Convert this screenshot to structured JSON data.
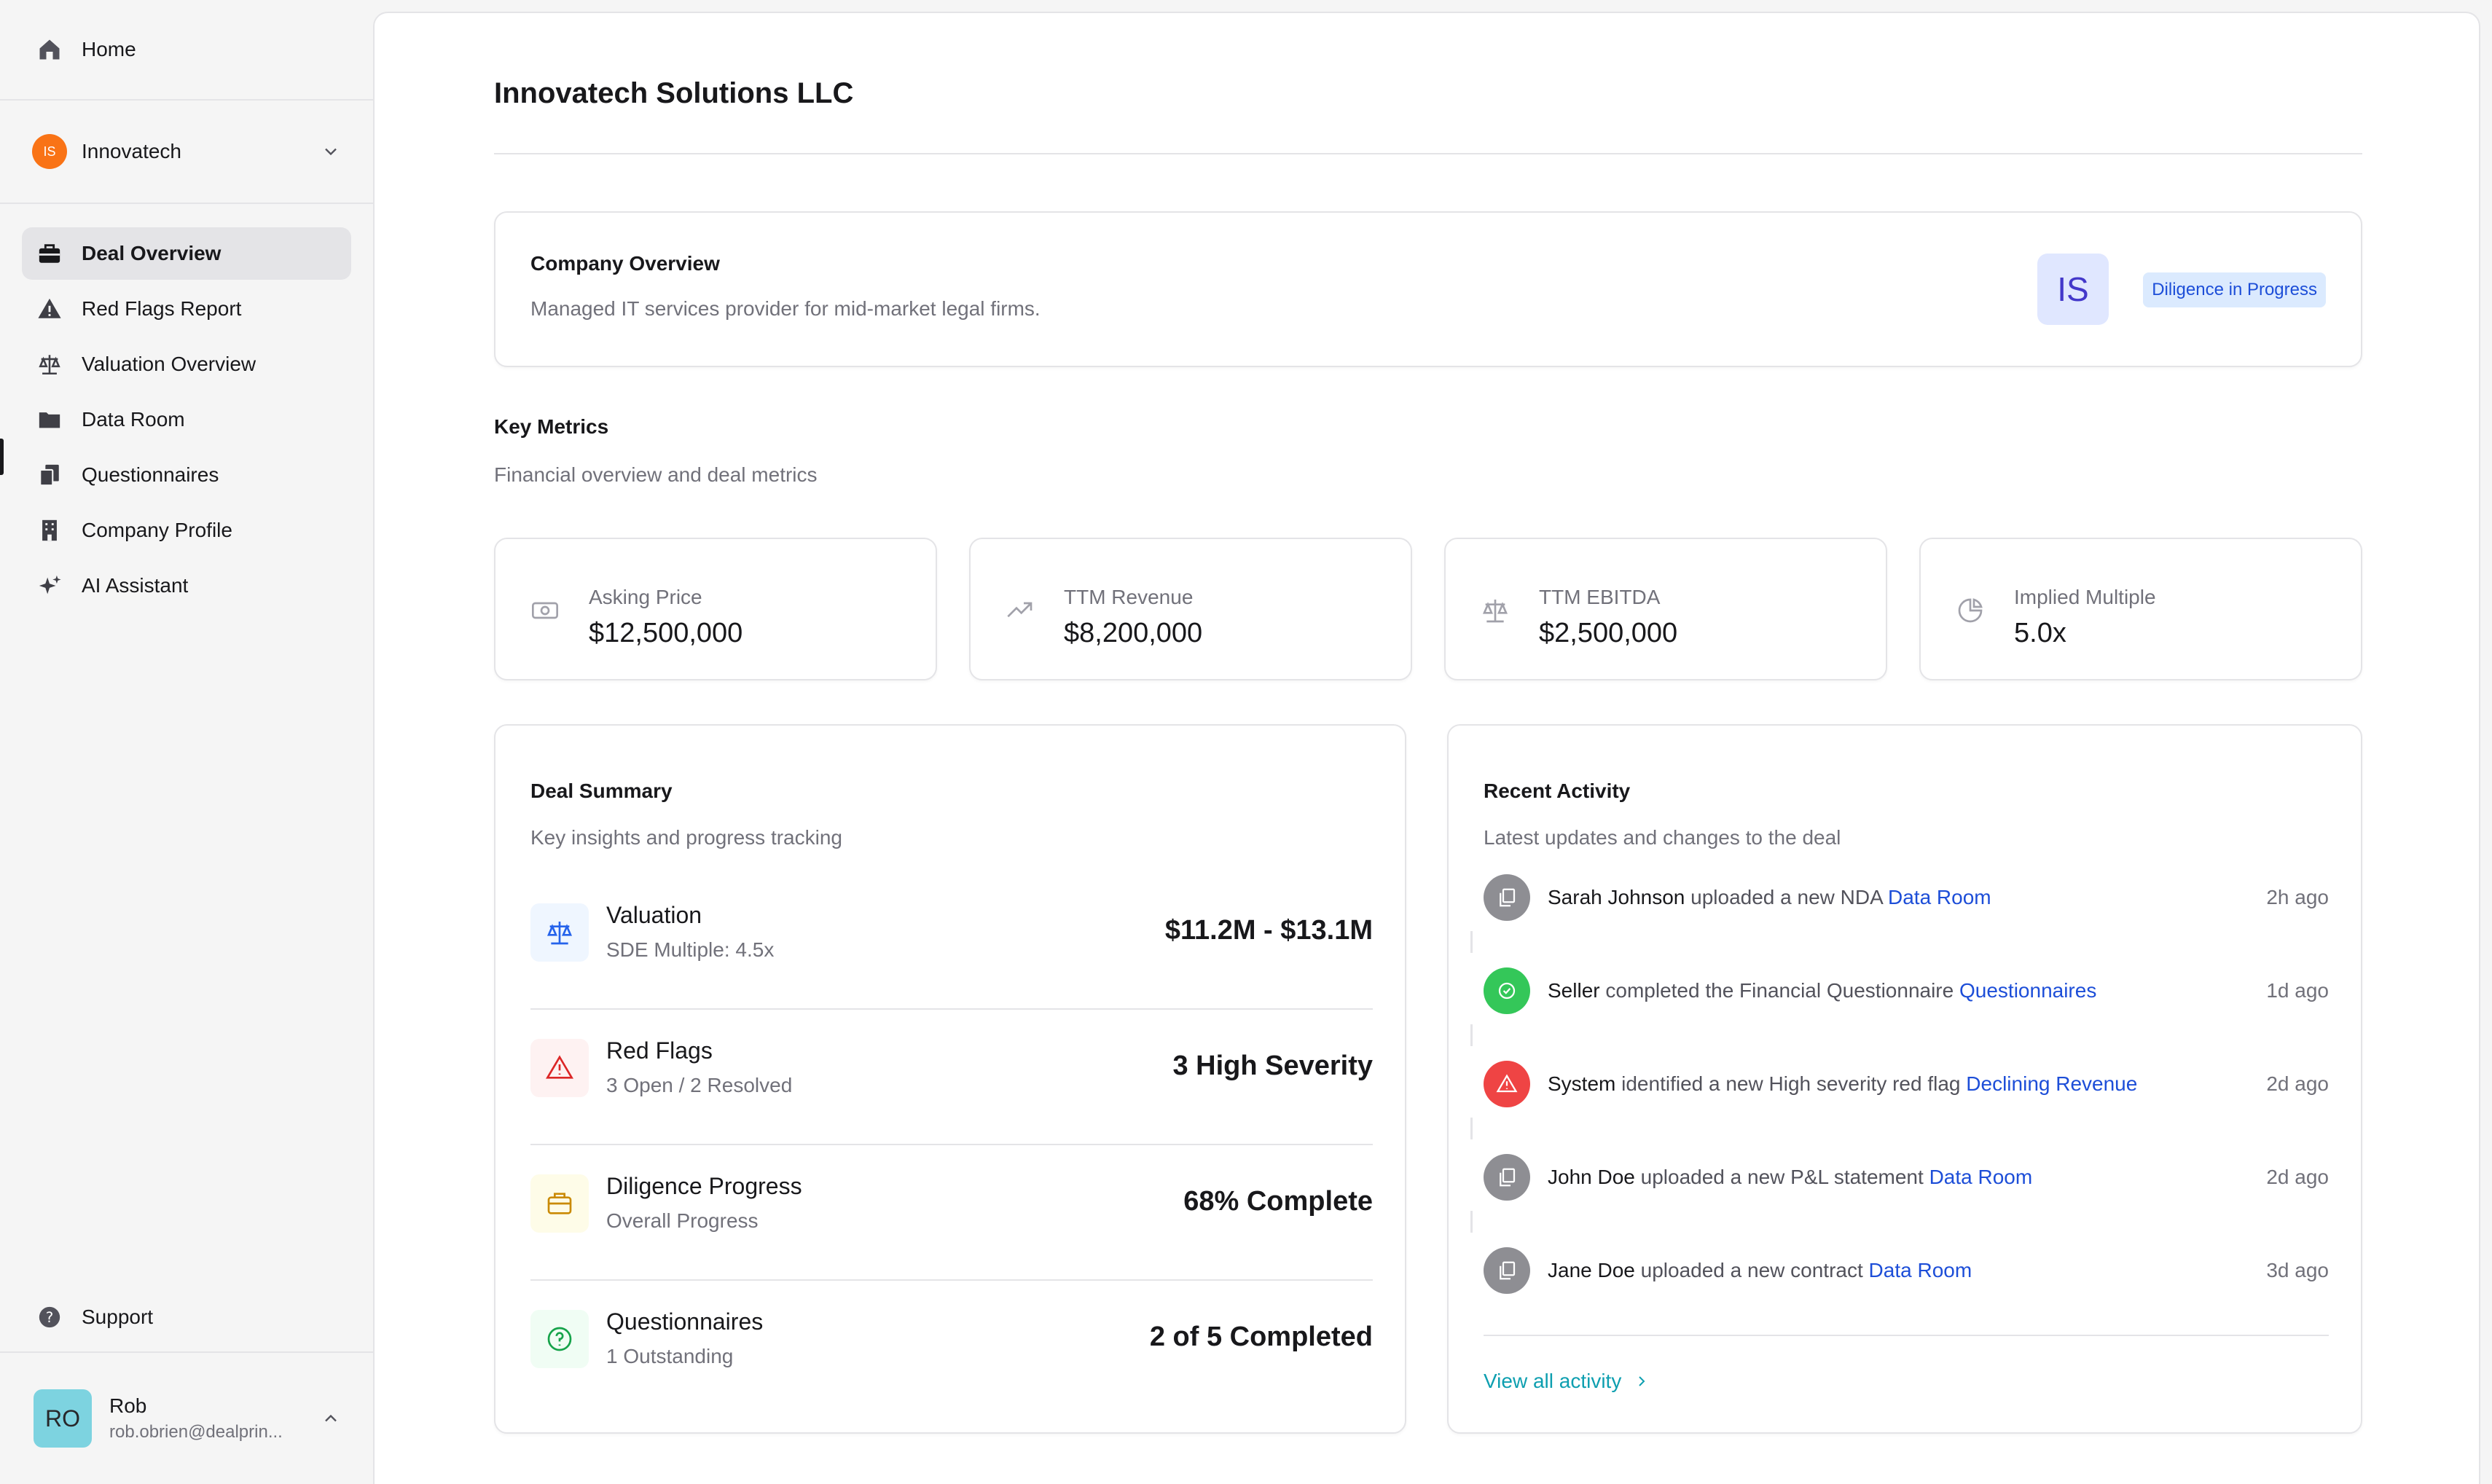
{
  "sidebar": {
    "home_label": "Home",
    "company": {
      "initials": "IS",
      "name": "Innovatech"
    },
    "nav": [
      {
        "label": "Deal Overview",
        "icon": "briefcase-icon",
        "active": true
      },
      {
        "label": "Red Flags Report",
        "icon": "warning-triangle-icon"
      },
      {
        "label": "Valuation Overview",
        "icon": "scale-icon"
      },
      {
        "label": "Data Room",
        "icon": "folder-icon"
      },
      {
        "label": "Questionnaires",
        "icon": "documents-icon"
      },
      {
        "label": "Company Profile",
        "icon": "building-icon"
      },
      {
        "label": "AI Assistant",
        "icon": "sparkles-icon"
      }
    ],
    "support_label": "Support",
    "user": {
      "initials": "RO",
      "name": "Rob",
      "email": "rob.obrien@dealprin..."
    }
  },
  "page": {
    "title": "Innovatech Solutions LLC"
  },
  "overview": {
    "title": "Company Overview",
    "description": "Managed IT services provider for mid-market legal firms.",
    "logo_initials": "IS",
    "status": "Diligence in Progress"
  },
  "key_metrics": {
    "title": "Key Metrics",
    "subtitle": "Financial overview and deal metrics",
    "items": [
      {
        "label": "Asking Price",
        "value": "$12,500,000",
        "icon": "banknote-icon"
      },
      {
        "label": "TTM Revenue",
        "value": "$8,200,000",
        "icon": "trending-up-icon"
      },
      {
        "label": "TTM EBITDA",
        "value": "$2,500,000",
        "icon": "scale-icon"
      },
      {
        "label": "Implied Multiple",
        "value": "5.0x",
        "icon": "pie-chart-icon"
      }
    ]
  },
  "deal_summary": {
    "title": "Deal Summary",
    "subtitle": "Key insights and progress tracking",
    "rows": [
      {
        "title": "Valuation",
        "subtitle": "SDE Multiple: 4.5x",
        "value": "$11.2M - $13.1M",
        "icon": "scale-icon",
        "color": "#2563eb",
        "bg": "#eff6ff"
      },
      {
        "title": "Red Flags",
        "subtitle": "3 Open / 2 Resolved",
        "value": "3 High Severity",
        "icon": "warning-triangle-icon",
        "color": "#dc2626",
        "bg": "#fef2f2"
      },
      {
        "title": "Diligence Progress",
        "subtitle": "Overall Progress",
        "value": "68% Complete",
        "icon": "briefcase-icon",
        "color": "#ca8a04",
        "bg": "#fefce8"
      },
      {
        "title": "Questionnaires",
        "subtitle": "1 Outstanding",
        "value": "2 of 5 Completed",
        "icon": "question-circle-icon",
        "color": "#16a34a",
        "bg": "#f0fdf4"
      }
    ]
  },
  "recent_activity": {
    "title": "Recent Activity",
    "subtitle": "Latest updates and changes to the deal",
    "items": [
      {
        "actor": "Sarah Johnson",
        "action": "uploaded a new NDA",
        "link": "Data Room",
        "time": "2h ago",
        "icon": "document-copy-icon",
        "color": "#8e8e93"
      },
      {
        "actor": "Seller",
        "action": "completed the Financial Questionnaire",
        "link": "Questionnaires",
        "time": "1d ago",
        "icon": "check-circle-icon",
        "color": "#34c759"
      },
      {
        "actor": "System",
        "action": "identified a new High severity red flag",
        "link": "Declining Revenue",
        "time": "2d ago",
        "icon": "warning-triangle-icon",
        "color": "#ef4444"
      },
      {
        "actor": "John Doe",
        "action": "uploaded a new P&L statement",
        "link": "Data Room",
        "time": "2d ago",
        "icon": "document-copy-icon",
        "color": "#8e8e93"
      },
      {
        "actor": "Jane Doe",
        "action": "uploaded a new contract",
        "link": "Data Room",
        "time": "3d ago",
        "icon": "document-copy-icon",
        "color": "#8e8e93"
      }
    ],
    "view_all": "View all activity"
  }
}
